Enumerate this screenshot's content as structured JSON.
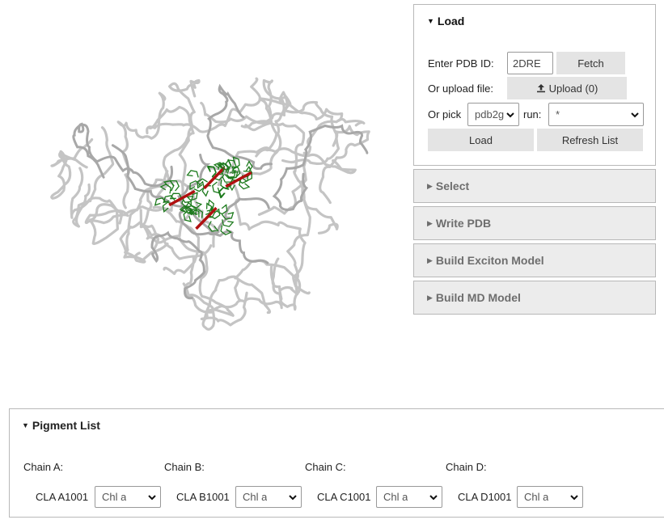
{
  "load": {
    "title": "Load",
    "pdb_label": "Enter PDB ID:",
    "pdb_value": "2DRE",
    "fetch": "Fetch",
    "upload_label": "Or upload file:",
    "upload_btn": "Upload (0)",
    "pick_label": "Or pick",
    "pick_value": "pdb2g",
    "run_label": "run:",
    "run_value": "*",
    "load_btn": "Load",
    "refresh_btn": "Refresh List"
  },
  "panels": {
    "select": "Select",
    "write_pdb": "Write PDB",
    "exciton": "Build Exciton Model",
    "md": "Build MD Model"
  },
  "pigment": {
    "title": "Pigment List",
    "chains": [
      {
        "label": "Chain A:",
        "residue": "CLA A1001",
        "type": "Chl a"
      },
      {
        "label": "Chain B:",
        "residue": "CLA B1001",
        "type": "Chl a"
      },
      {
        "label": "Chain C:",
        "residue": "CLA C1001",
        "type": "Chl a"
      },
      {
        "label": "Chain D:",
        "residue": "CLA D1001",
        "type": "Chl a"
      }
    ]
  },
  "colors": {
    "protein": "#c4c4c4",
    "pigment_ring": "#1c7a1c",
    "pigment_core": "#b01010"
  }
}
